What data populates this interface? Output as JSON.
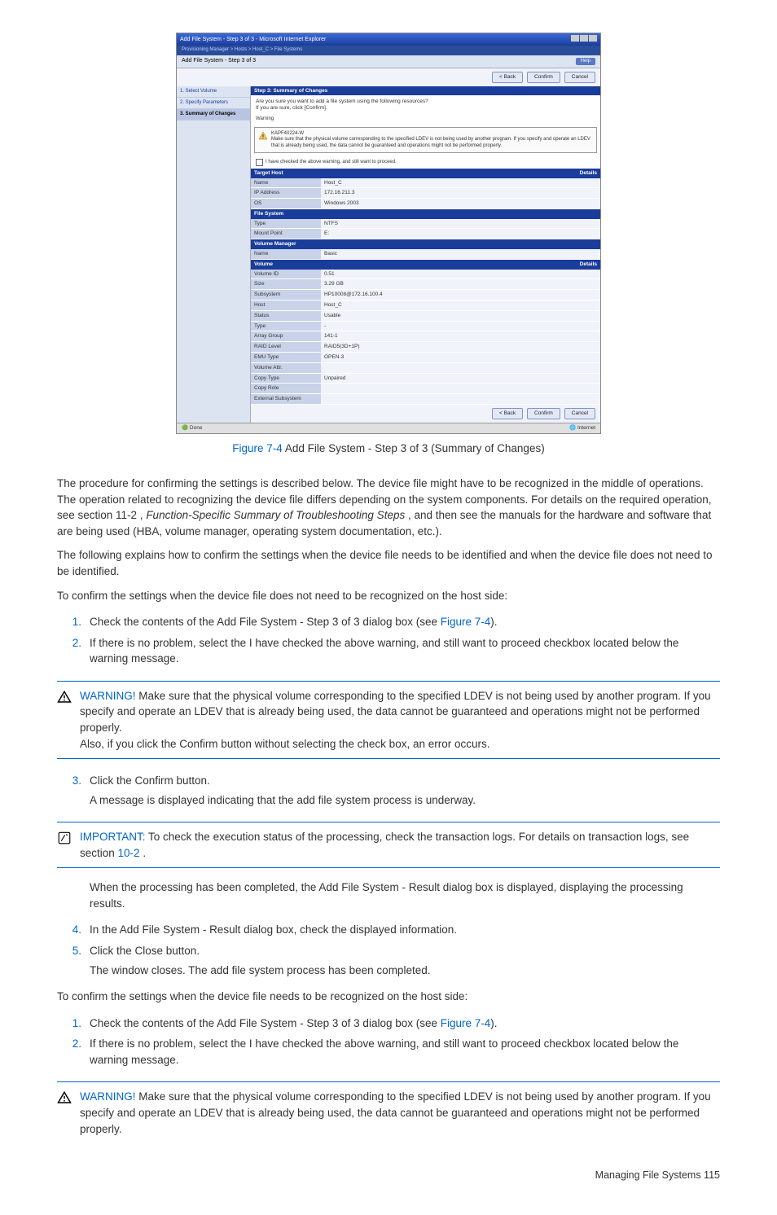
{
  "screenshot": {
    "title": "Add File System - Step 3 of 3 - Microsoft Internet Explorer",
    "breadcrumb": "Provisioning Manager > Hosts > Host_C > File Systems",
    "subheader": "Add File System - Step 3 of 3",
    "help": "Help",
    "buttons": {
      "back": "< Back",
      "confirm": "Confirm",
      "cancel": "Cancel"
    },
    "nav": {
      "step1": "1. Select Volume",
      "step2": "2. Specify Parameters",
      "step3": "3. Summary of Changes"
    },
    "section_title": "Step 3: Summary of Changes",
    "question": "Are you sure you want to add a file system using the following resources?\nIf you are sure, click [Confirm].",
    "warning_label": "Warning",
    "warning_code": "KAPF40224-W",
    "warning_body": "Make sure that the physical volume corresponding to the specified LDEV is not being used by another program. If you specify and operate an LDEV that is already being used, the data cannot be guaranteed and operations might not be performed properly.",
    "checkbox_label": "I have checked the above warning, and still want to proceed.",
    "details": "Details",
    "target_host": {
      "title": "Target Host",
      "rows": [
        [
          "Name",
          "Host_C"
        ],
        [
          "IP Address",
          "172.16.211.3"
        ],
        [
          "OS",
          "Windows 2003"
        ]
      ]
    },
    "file_system": {
      "title": "File System",
      "rows": [
        [
          "Type",
          "NTFS"
        ],
        [
          "Mount Point",
          "E:"
        ]
      ]
    },
    "volume_manager": {
      "title": "Volume Manager",
      "rows": [
        [
          "Name",
          "Basic"
        ]
      ]
    },
    "volume": {
      "title": "Volume",
      "rows": [
        [
          "Volume ID",
          "0.51"
        ],
        [
          "Size",
          "3.29 GB"
        ],
        [
          "Subsystem",
          "HP10008@172.16.100.4"
        ],
        [
          "Host",
          "Host_C"
        ],
        [
          "Status",
          "Usable"
        ],
        [
          "Type",
          "-"
        ],
        [
          "Array Group",
          "141-1"
        ],
        [
          "RAID Level",
          "RAID5(3D+1P)"
        ],
        [
          "EMU Type",
          "OPEN-3"
        ],
        [
          "Volume Attr.",
          ""
        ],
        [
          "Copy Type",
          "Unpaired"
        ],
        [
          "Copy Role",
          ""
        ],
        [
          "External Subsystem",
          ""
        ]
      ]
    },
    "status_done": "Done",
    "status_net": "Internet"
  },
  "fig": {
    "num": "Figure 7-4",
    "caption": " Add File System - Step 3 of 3 (Summary of Changes)"
  },
  "para1a": "The procedure for confirming the settings is described below. The device file might have to be recognized in the middle of operations. The operation related to recognizing the device file differs depending on the system components. For details on the required operation, see section 11-2 , ",
  "para1b": "Function-Specific Summary of Troubleshooting Steps",
  "para1c": " , and then see the manuals for the hardware and software that are being used (HBA, volume manager, operating system documentation, etc.).",
  "para2": "The following explains how to confirm the settings when the device file needs to be identified and when the device file does not need to be identified.",
  "para3": "To confirm the settings when the device file does not need to be recognized on the host side:",
  "stepsA": {
    "1a": "Check the contents of the Add File System - Step 3 of 3 dialog box (see ",
    "1link": "Figure 7-4",
    "1b": ").",
    "2": "If there is no problem, select the I have checked the above warning, and still want to proceed checkbox located below the warning message."
  },
  "warn1": {
    "label": "WARNING!",
    "text": "  Make sure that the physical volume corresponding to the specified LDEV is not being used by another program. If you specify and operate an LDEV that is already being used, the data cannot be guaranteed and operations might not be performed properly.",
    "text2": "Also, if you click the Confirm button without selecting the check box, an error occurs."
  },
  "stepsB": {
    "3a": "Click the Confirm button.",
    "3b": "A message is displayed indicating that the add file system process is underway."
  },
  "important": {
    "label": "IMPORTANT:",
    "text1": "  To check the execution status of the processing, check the transaction logs. For details on transaction logs, see section ",
    "link": "10-2",
    "text2": " ."
  },
  "para_after_imp": "When the processing has been completed, the Add File System - Result dialog box is displayed, displaying the processing results.",
  "stepsC": {
    "4": "In the Add File System - Result dialog box, check the displayed information.",
    "5a": "Click the Close button.",
    "5b": "The window closes. The add file system process has been completed."
  },
  "para4": "To confirm the settings when the device file needs to be recognized on the host side:",
  "stepsD": {
    "1a": "Check the contents of the Add File System - Step 3 of 3 dialog box (see ",
    "1link": "Figure 7-4",
    "1b": ").",
    "2": "If there is no problem, select the I have checked the above warning, and still want to proceed checkbox located below the warning message."
  },
  "warn2": {
    "label": "WARNING!",
    "text": "  Make sure that the physical volume corresponding to the specified LDEV is not being used by another program. If you specify and operate an LDEV that is already being used, the data cannot be guaranteed and operations might not be performed properly."
  },
  "footer": {
    "text": "Managing File Systems  115"
  }
}
